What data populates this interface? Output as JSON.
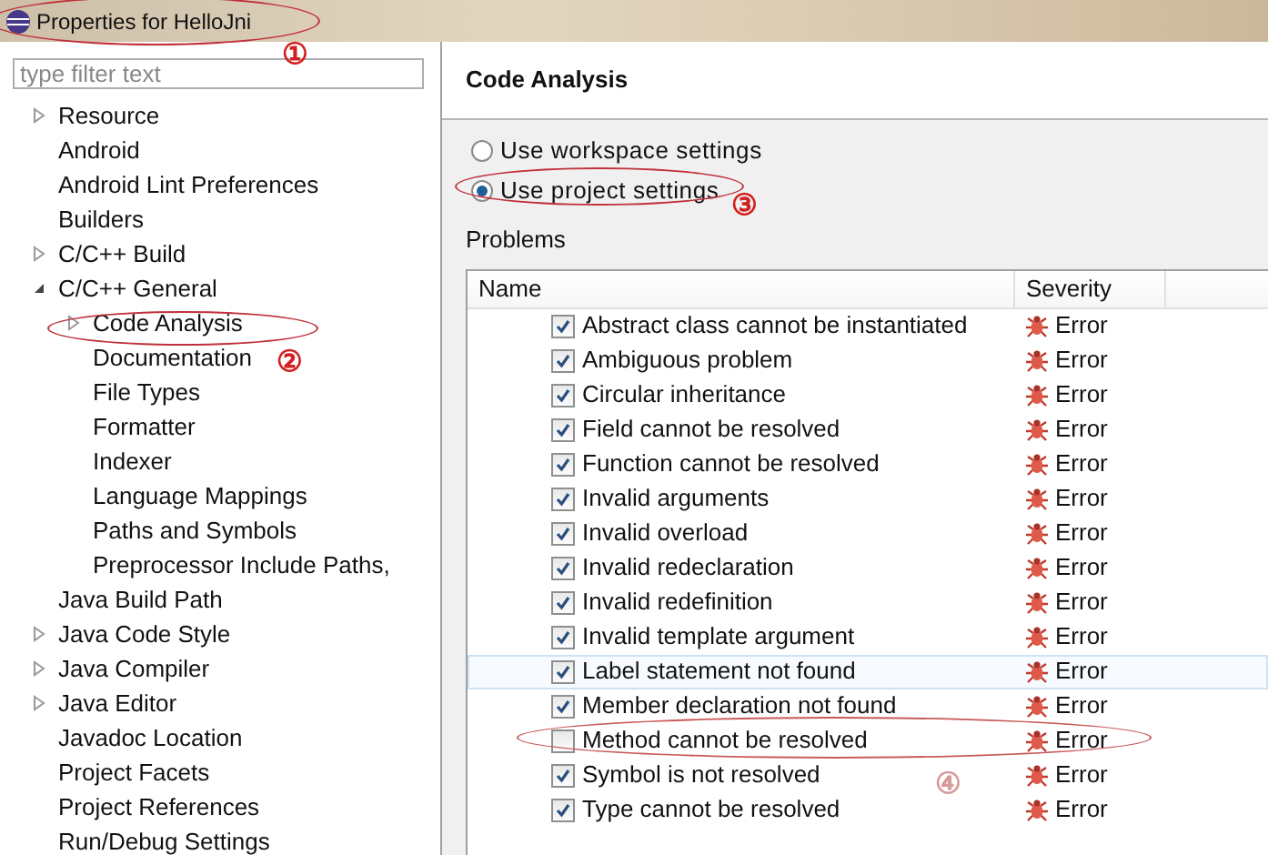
{
  "window": {
    "title": "Properties for HelloJni"
  },
  "filter": {
    "placeholder": "type filter text"
  },
  "tree": [
    {
      "label": "Resource",
      "expanded": false
    },
    {
      "label": "Android"
    },
    {
      "label": "Android Lint Preferences"
    },
    {
      "label": "Builders"
    },
    {
      "label": "C/C++ Build",
      "expanded": false
    },
    {
      "label": "C/C++ General",
      "expanded": true,
      "children": [
        {
          "label": "Code Analysis",
          "expanded": false
        },
        {
          "label": "Documentation"
        },
        {
          "label": "File Types"
        },
        {
          "label": "Formatter"
        },
        {
          "label": "Indexer"
        },
        {
          "label": "Language Mappings"
        },
        {
          "label": "Paths and Symbols"
        },
        {
          "label": "Preprocessor Include Paths,"
        }
      ]
    },
    {
      "label": "Java Build Path"
    },
    {
      "label": "Java Code Style",
      "expanded": false
    },
    {
      "label": "Java Compiler",
      "expanded": false
    },
    {
      "label": "Java Editor",
      "expanded": false
    },
    {
      "label": "Javadoc Location"
    },
    {
      "label": "Project Facets"
    },
    {
      "label": "Project References"
    },
    {
      "label": "Run/Debug Settings"
    }
  ],
  "page": {
    "title": "Code Analysis",
    "radios": [
      {
        "label": "Use workspace settings",
        "selected": false
      },
      {
        "label": "Use project settings",
        "selected": true
      }
    ],
    "problems_label": "Problems",
    "columns": [
      "Name",
      "Severity"
    ],
    "rows": [
      {
        "name": "Abstract class cannot be instantiated",
        "severity": "Error",
        "checked": true,
        "highlighted": false
      },
      {
        "name": "Ambiguous problem",
        "severity": "Error",
        "checked": true,
        "highlighted": false
      },
      {
        "name": "Circular inheritance",
        "severity": "Error",
        "checked": true,
        "highlighted": false
      },
      {
        "name": "Field cannot be resolved",
        "severity": "Error",
        "checked": true,
        "highlighted": false
      },
      {
        "name": "Function cannot be resolved",
        "severity": "Error",
        "checked": true,
        "highlighted": false
      },
      {
        "name": "Invalid arguments",
        "severity": "Error",
        "checked": true,
        "highlighted": false
      },
      {
        "name": "Invalid overload",
        "severity": "Error",
        "checked": true,
        "highlighted": false
      },
      {
        "name": "Invalid redeclaration",
        "severity": "Error",
        "checked": true,
        "highlighted": false
      },
      {
        "name": "Invalid redefinition",
        "severity": "Error",
        "checked": true,
        "highlighted": false
      },
      {
        "name": "Invalid template argument",
        "severity": "Error",
        "checked": true,
        "highlighted": false
      },
      {
        "name": "Label statement not found",
        "severity": "Error",
        "checked": true,
        "highlighted": true
      },
      {
        "name": "Member declaration not found",
        "severity": "Error",
        "checked": true,
        "highlighted": false
      },
      {
        "name": "Method cannot be resolved",
        "severity": "Error",
        "checked": false,
        "highlighted": false
      },
      {
        "name": "Symbol is not resolved",
        "severity": "Error",
        "checked": true,
        "highlighted": false
      },
      {
        "name": "Type cannot be resolved",
        "severity": "Error",
        "checked": true,
        "highlighted": false
      }
    ]
  },
  "annotations": [
    {
      "label": "①"
    },
    {
      "label": "②"
    },
    {
      "label": "③"
    },
    {
      "label": "④"
    }
  ]
}
